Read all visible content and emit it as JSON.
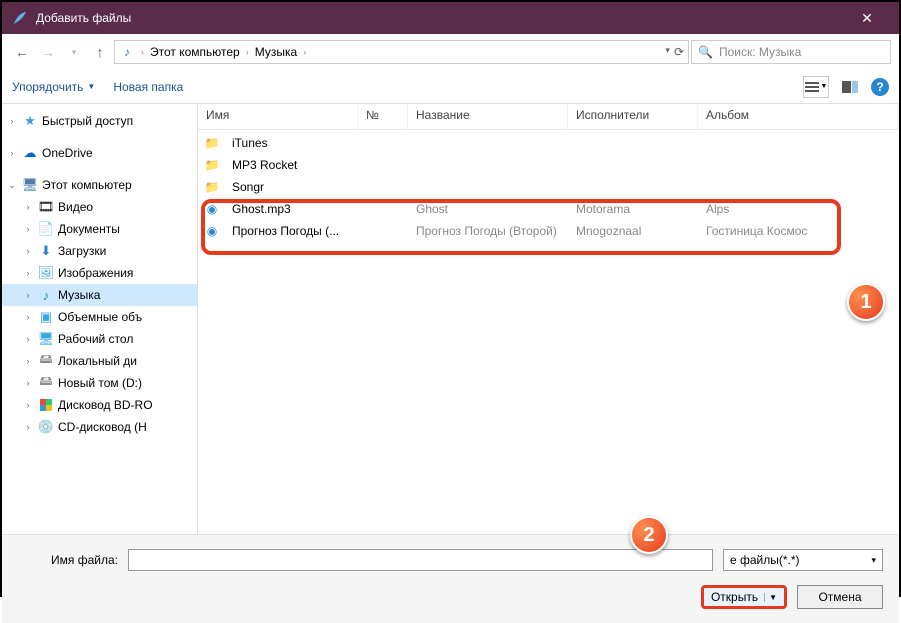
{
  "title": "Добавить файлы",
  "nav": {
    "path": [
      "Этот компьютер",
      "Музыка"
    ],
    "search_placeholder": "Поиск: Музыка"
  },
  "toolbar": {
    "organize": "Упорядочить",
    "newfolder": "Новая папка"
  },
  "columns": {
    "name": "Имя",
    "num": "№",
    "title": "Название",
    "artist": "Исполнители",
    "album": "Альбом"
  },
  "sidebar": {
    "quick": "Быстрый доступ",
    "onedrive": "OneDrive",
    "thispc": "Этот компьютер",
    "items": [
      "Видео",
      "Документы",
      "Загрузки",
      "Изображения",
      "Музыка",
      "Объемные объ",
      "Рабочий стол",
      "Локальный ди",
      "Новый том (D:)",
      "Дисковод BD-RO",
      "CD-дисковод (H"
    ]
  },
  "files": {
    "folders": [
      "iTunes",
      "MP3 Rocket",
      "Songr"
    ],
    "tracks": [
      {
        "name": "Ghost.mp3",
        "title": "Ghost",
        "artist": "Motorama",
        "album": "Alps"
      },
      {
        "name": "Прогноз Погоды (...",
        "title": "Прогноз Погоды (Второй)",
        "artist": "Mnogoznaal",
        "album": "Гостиница Космос"
      }
    ]
  },
  "footer": {
    "filename_label": "Имя файла:",
    "filetype": "е файлы(*.*)",
    "open": "Открыть",
    "cancel": "Отмена"
  },
  "badges": {
    "one": "1",
    "two": "2"
  }
}
